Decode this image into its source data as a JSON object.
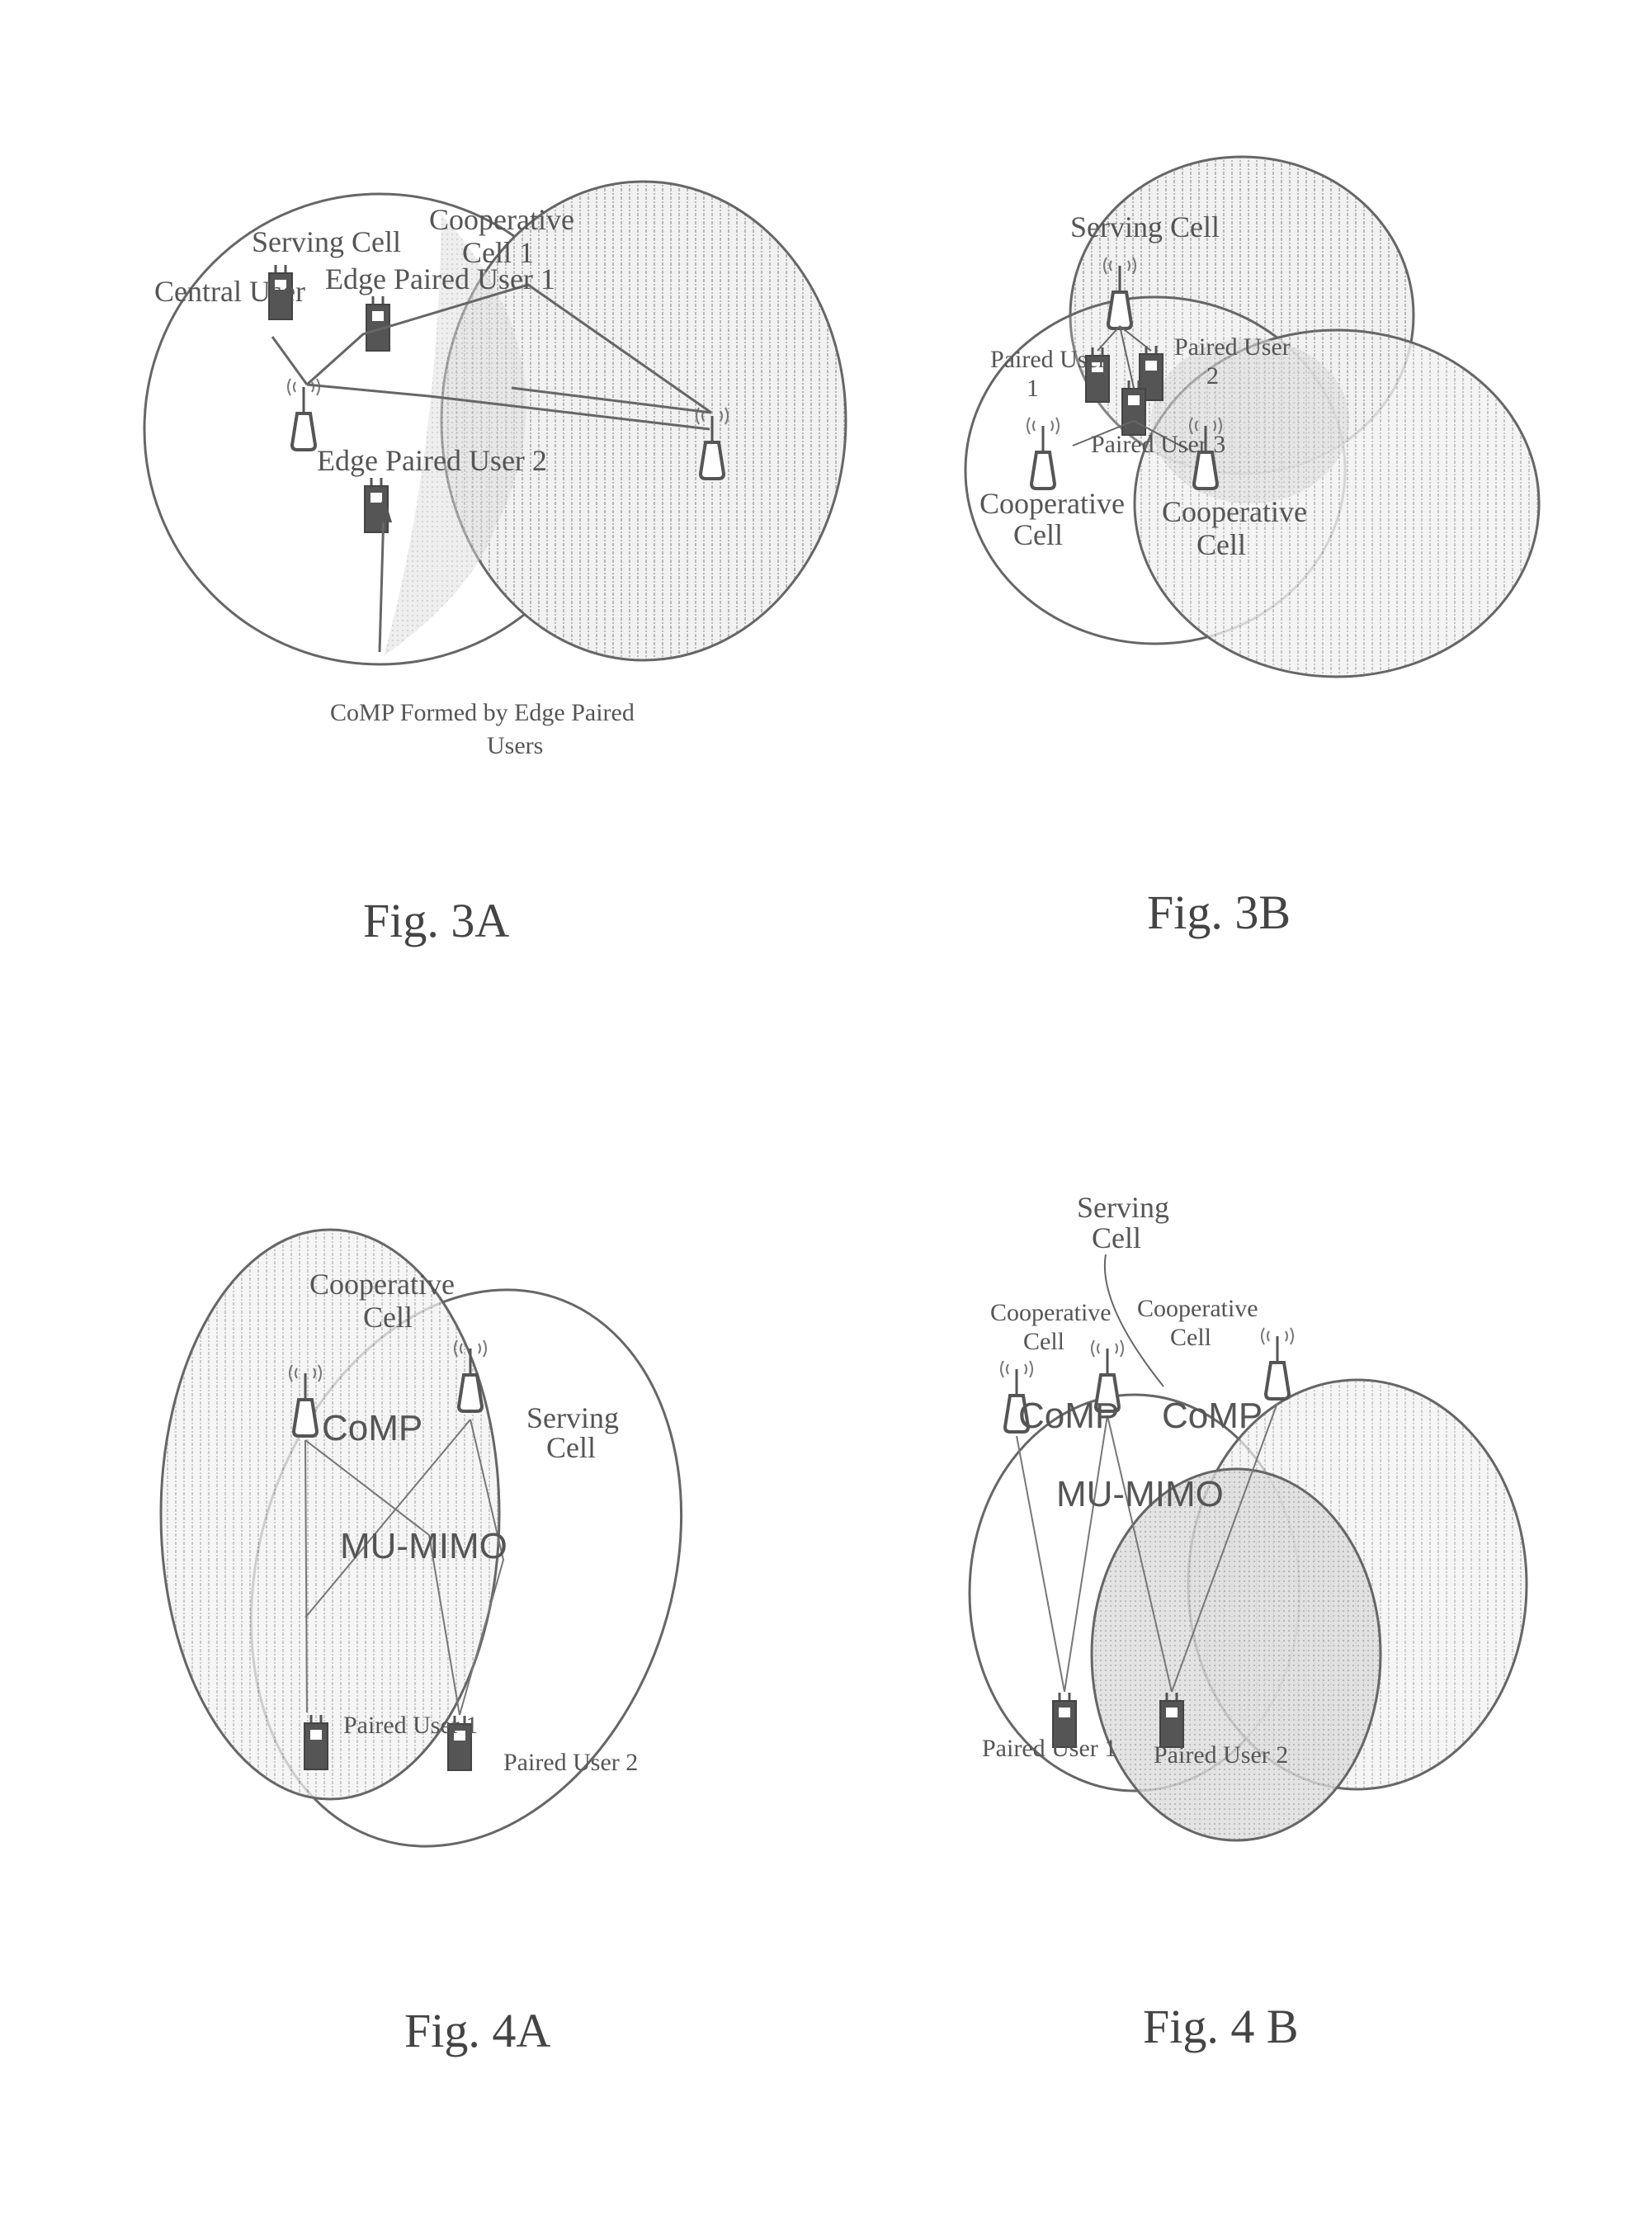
{
  "figures": {
    "fig3a": {
      "caption": "Fig. 3A",
      "labels": {
        "serving_cell": "Serving Cell",
        "cooperative_cell_line1": "Cooperative",
        "cooperative_cell_line2": "Cell 1",
        "central_user": "Central User",
        "edge_paired_user_1": "Edge Paired User 1",
        "edge_paired_user_2": "Edge Paired User 2",
        "comp_callout_line1": "CoMP Formed by Edge Paired",
        "comp_callout_line2": "Users"
      }
    },
    "fig3b": {
      "caption": "Fig. 3B",
      "labels": {
        "serving_cell": "Serving Cell",
        "paired_user_1_line1": "Paired User",
        "paired_user_1_line2": "1",
        "paired_user_2_line1": "Paired User",
        "paired_user_2_line2": "2",
        "paired_user_3": "Paired User 3",
        "cooperative_cell_left_line1": "Cooperative",
        "cooperative_cell_left_line2": "Cell",
        "cooperative_cell_right_line1": "Cooperative",
        "cooperative_cell_right_line2": "Cell"
      }
    },
    "fig4a": {
      "caption": "Fig. 4A",
      "labels": {
        "cooperative_cell_line1": "Cooperative",
        "cooperative_cell_line2": "Cell",
        "serving_cell_line1": "Serving",
        "serving_cell_line2": "Cell",
        "comp": "CoMP",
        "mu_mimo": "MU-MIMO",
        "paired_user_1": "Paired User 1",
        "paired_user_2": "Paired User 2"
      }
    },
    "fig4b": {
      "caption": "Fig. 4 B",
      "labels": {
        "serving_cell_line1": "Serving",
        "serving_cell_line2": "Cell",
        "cooperative_cell_left_line1": "Cooperative",
        "cooperative_cell_left_line2": "Cell",
        "cooperative_cell_right_line1": "Cooperative",
        "cooperative_cell_right_line2": "Cell",
        "comp_left": "CoMP",
        "comp_right": "CoMP",
        "mu_mimo": "MU-MIMO",
        "paired_user_1": "Paired User 1",
        "paired_user_2": "Paired User 2"
      }
    }
  },
  "colors": {
    "line": "#666666",
    "hatch_fill": "#e6e6e6",
    "overlap_fill": "#cfcfcf",
    "device_fill": "#555555",
    "text": "#555555"
  }
}
